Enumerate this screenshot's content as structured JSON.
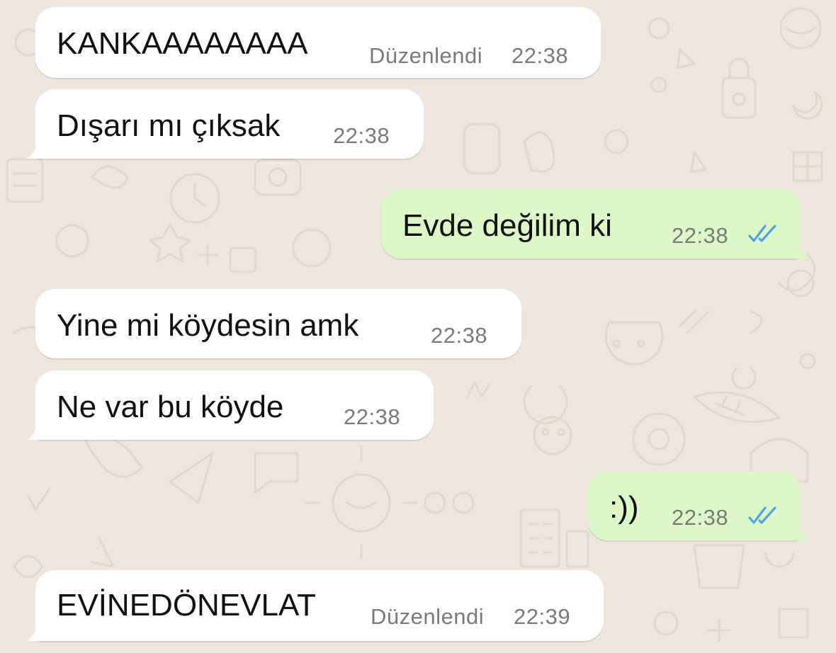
{
  "colors": {
    "incoming_bubble": "#ffffff",
    "outgoing_bubble": "#dcf8c6",
    "wallpaper": "#efe7dd",
    "read_ticks": "#4fa3e8"
  },
  "messages": [
    {
      "direction": "incoming",
      "text": "KANKAAAAAAAA",
      "edited_label": "Düzenlendi",
      "time": "22:38"
    },
    {
      "direction": "incoming",
      "text": "Dışarı mı çıksak",
      "time": "22:38"
    },
    {
      "direction": "outgoing",
      "text": "Evde değilim ki",
      "time": "22:38",
      "status_icon": "double-check-read-icon"
    },
    {
      "direction": "incoming",
      "text": "Yine mi köydesin amk",
      "time": "22:38"
    },
    {
      "direction": "incoming",
      "text": "Ne var bu köyde",
      "time": "22:38"
    },
    {
      "direction": "outgoing",
      "text": ":))",
      "time": "22:38",
      "status_icon": "double-check-read-icon"
    },
    {
      "direction": "incoming",
      "text": "EVİNEDÖNEVLAT",
      "edited_label": "Düzenlendi",
      "time": "22:39"
    }
  ]
}
